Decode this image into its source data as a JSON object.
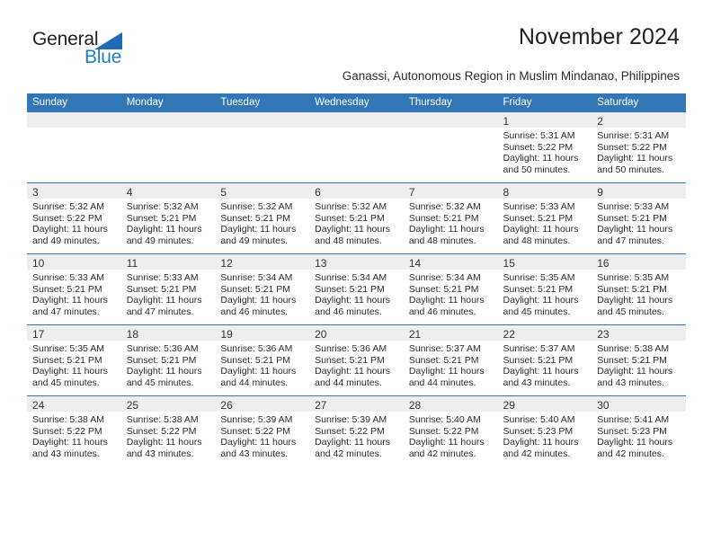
{
  "logo": {
    "word1": "General",
    "word2": "Blue",
    "triangle_color": "#1f6cb4",
    "word1_color": "#231f20",
    "word2_color": "#1f7ec4"
  },
  "header": {
    "title": "November 2024",
    "subtitle": "Ganassi, Autonomous Region in Muslim Mindanao, Philippines"
  },
  "theme": {
    "header_blue": "#3277b5",
    "daynum_strip": "#eeeeee",
    "text": "#2b2b2b"
  },
  "calendar": {
    "weekday_headers": [
      "Sunday",
      "Monday",
      "Tuesday",
      "Wednesday",
      "Thursday",
      "Friday",
      "Saturday"
    ],
    "weeks": [
      [
        {
          "empty": true
        },
        {
          "empty": true
        },
        {
          "empty": true
        },
        {
          "empty": true
        },
        {
          "empty": true
        },
        {
          "day": "1",
          "line1": "Sunrise: 5:31 AM",
          "line2": "Sunset: 5:22 PM",
          "line3": "Daylight: 11 hours",
          "line4": "and 50 minutes."
        },
        {
          "day": "2",
          "line1": "Sunrise: 5:31 AM",
          "line2": "Sunset: 5:22 PM",
          "line3": "Daylight: 11 hours",
          "line4": "and 50 minutes."
        }
      ],
      [
        {
          "day": "3",
          "line1": "Sunrise: 5:32 AM",
          "line2": "Sunset: 5:22 PM",
          "line3": "Daylight: 11 hours",
          "line4": "and 49 minutes."
        },
        {
          "day": "4",
          "line1": "Sunrise: 5:32 AM",
          "line2": "Sunset: 5:21 PM",
          "line3": "Daylight: 11 hours",
          "line4": "and 49 minutes."
        },
        {
          "day": "5",
          "line1": "Sunrise: 5:32 AM",
          "line2": "Sunset: 5:21 PM",
          "line3": "Daylight: 11 hours",
          "line4": "and 49 minutes."
        },
        {
          "day": "6",
          "line1": "Sunrise: 5:32 AM",
          "line2": "Sunset: 5:21 PM",
          "line3": "Daylight: 11 hours",
          "line4": "and 48 minutes."
        },
        {
          "day": "7",
          "line1": "Sunrise: 5:32 AM",
          "line2": "Sunset: 5:21 PM",
          "line3": "Daylight: 11 hours",
          "line4": "and 48 minutes."
        },
        {
          "day": "8",
          "line1": "Sunrise: 5:33 AM",
          "line2": "Sunset: 5:21 PM",
          "line3": "Daylight: 11 hours",
          "line4": "and 48 minutes."
        },
        {
          "day": "9",
          "line1": "Sunrise: 5:33 AM",
          "line2": "Sunset: 5:21 PM",
          "line3": "Daylight: 11 hours",
          "line4": "and 47 minutes."
        }
      ],
      [
        {
          "day": "10",
          "line1": "Sunrise: 5:33 AM",
          "line2": "Sunset: 5:21 PM",
          "line3": "Daylight: 11 hours",
          "line4": "and 47 minutes."
        },
        {
          "day": "11",
          "line1": "Sunrise: 5:33 AM",
          "line2": "Sunset: 5:21 PM",
          "line3": "Daylight: 11 hours",
          "line4": "and 47 minutes."
        },
        {
          "day": "12",
          "line1": "Sunrise: 5:34 AM",
          "line2": "Sunset: 5:21 PM",
          "line3": "Daylight: 11 hours",
          "line4": "and 46 minutes."
        },
        {
          "day": "13",
          "line1": "Sunrise: 5:34 AM",
          "line2": "Sunset: 5:21 PM",
          "line3": "Daylight: 11 hours",
          "line4": "and 46 minutes."
        },
        {
          "day": "14",
          "line1": "Sunrise: 5:34 AM",
          "line2": "Sunset: 5:21 PM",
          "line3": "Daylight: 11 hours",
          "line4": "and 46 minutes."
        },
        {
          "day": "15",
          "line1": "Sunrise: 5:35 AM",
          "line2": "Sunset: 5:21 PM",
          "line3": "Daylight: 11 hours",
          "line4": "and 45 minutes."
        },
        {
          "day": "16",
          "line1": "Sunrise: 5:35 AM",
          "line2": "Sunset: 5:21 PM",
          "line3": "Daylight: 11 hours",
          "line4": "and 45 minutes."
        }
      ],
      [
        {
          "day": "17",
          "line1": "Sunrise: 5:35 AM",
          "line2": "Sunset: 5:21 PM",
          "line3": "Daylight: 11 hours",
          "line4": "and 45 minutes."
        },
        {
          "day": "18",
          "line1": "Sunrise: 5:36 AM",
          "line2": "Sunset: 5:21 PM",
          "line3": "Daylight: 11 hours",
          "line4": "and 45 minutes."
        },
        {
          "day": "19",
          "line1": "Sunrise: 5:36 AM",
          "line2": "Sunset: 5:21 PM",
          "line3": "Daylight: 11 hours",
          "line4": "and 44 minutes."
        },
        {
          "day": "20",
          "line1": "Sunrise: 5:36 AM",
          "line2": "Sunset: 5:21 PM",
          "line3": "Daylight: 11 hours",
          "line4": "and 44 minutes."
        },
        {
          "day": "21",
          "line1": "Sunrise: 5:37 AM",
          "line2": "Sunset: 5:21 PM",
          "line3": "Daylight: 11 hours",
          "line4": "and 44 minutes."
        },
        {
          "day": "22",
          "line1": "Sunrise: 5:37 AM",
          "line2": "Sunset: 5:21 PM",
          "line3": "Daylight: 11 hours",
          "line4": "and 43 minutes."
        },
        {
          "day": "23",
          "line1": "Sunrise: 5:38 AM",
          "line2": "Sunset: 5:21 PM",
          "line3": "Daylight: 11 hours",
          "line4": "and 43 minutes."
        }
      ],
      [
        {
          "day": "24",
          "line1": "Sunrise: 5:38 AM",
          "line2": "Sunset: 5:22 PM",
          "line3": "Daylight: 11 hours",
          "line4": "and 43 minutes."
        },
        {
          "day": "25",
          "line1": "Sunrise: 5:38 AM",
          "line2": "Sunset: 5:22 PM",
          "line3": "Daylight: 11 hours",
          "line4": "and 43 minutes."
        },
        {
          "day": "26",
          "line1": "Sunrise: 5:39 AM",
          "line2": "Sunset: 5:22 PM",
          "line3": "Daylight: 11 hours",
          "line4": "and 43 minutes."
        },
        {
          "day": "27",
          "line1": "Sunrise: 5:39 AM",
          "line2": "Sunset: 5:22 PM",
          "line3": "Daylight: 11 hours",
          "line4": "and 42 minutes."
        },
        {
          "day": "28",
          "line1": "Sunrise: 5:40 AM",
          "line2": "Sunset: 5:22 PM",
          "line3": "Daylight: 11 hours",
          "line4": "and 42 minutes."
        },
        {
          "day": "29",
          "line1": "Sunrise: 5:40 AM",
          "line2": "Sunset: 5:23 PM",
          "line3": "Daylight: 11 hours",
          "line4": "and 42 minutes."
        },
        {
          "day": "30",
          "line1": "Sunrise: 5:41 AM",
          "line2": "Sunset: 5:23 PM",
          "line3": "Daylight: 11 hours",
          "line4": "and 42 minutes."
        }
      ]
    ]
  }
}
